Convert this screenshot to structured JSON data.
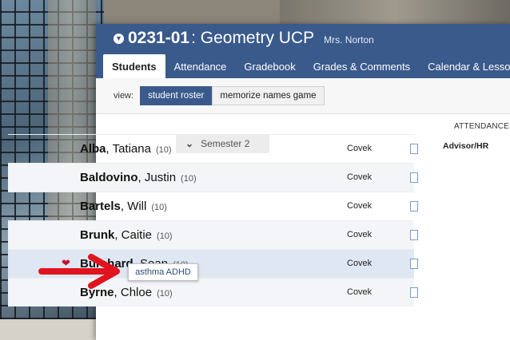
{
  "header": {
    "course_code": "0231-01",
    "course_name": "Geometry UCP",
    "teacher": "Mrs. Norton"
  },
  "tabs": [
    {
      "label": "Students",
      "active": true
    },
    {
      "label": "Attendance"
    },
    {
      "label": "Gradebook"
    },
    {
      "label": "Grades & Comments"
    },
    {
      "label": "Calendar & Lessons"
    }
  ],
  "view": {
    "label": "view:",
    "options": [
      "student roster",
      "memorize names game"
    ],
    "selected": "student roster"
  },
  "roster": {
    "semester_label": "Semester 2",
    "attendance_header": "ATTENDANCE",
    "advisor_header": "Advisor/HR",
    "students": [
      {
        "last": "Alba",
        "first": ", Tatiana",
        "grade": "(10)",
        "advisor": "Covek"
      },
      {
        "last": "Baldovino",
        "first": ", Justin",
        "grade": "(10)",
        "advisor": "Covek"
      },
      {
        "last": "Bartels",
        "first": ", Will",
        "grade": "(10)",
        "advisor": "Covek"
      },
      {
        "last": "Brunk",
        "first": ", Caitie",
        "grade": "(10)",
        "advisor": "Covek"
      },
      {
        "last": "Burchard",
        "first": ", Sean",
        "grade": "(10)",
        "advisor": "Covek"
      },
      {
        "last": "Byrne",
        "first": ", Chloe",
        "grade": "(10)",
        "advisor": "Covek"
      }
    ]
  },
  "tooltip": {
    "text": "asthma ADHD"
  },
  "colors": {
    "header_bg": "#3a5a8c",
    "medical_icon": "#c8102e",
    "arrow": "#e0141e"
  },
  "icons": {
    "medical": "heartbeat-icon",
    "row_action": "note-icon",
    "annotation": "red-arrow"
  }
}
